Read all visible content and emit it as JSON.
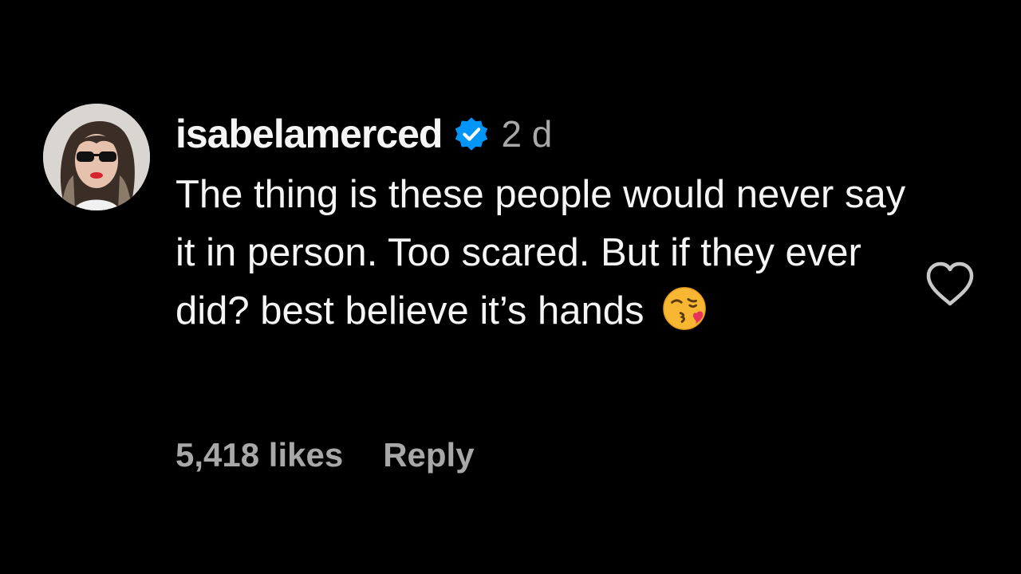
{
  "comment": {
    "username": "isabelamerced",
    "verified_icon": "verified-badge-icon",
    "timestamp": "2 d",
    "text": "The thing is these people would never say it in person. Too scared. But if they ever did? best believe it’s hands",
    "emoji_icon": "face-blowing-kiss-emoji",
    "likes": "5,418 likes",
    "reply_label": "Reply",
    "like_icon": "heart-outline-icon"
  },
  "colors": {
    "background": "#000000",
    "primary_text": "#f5f5f5",
    "secondary_text": "#a8a8a8",
    "verified_blue": "#0095f6"
  }
}
